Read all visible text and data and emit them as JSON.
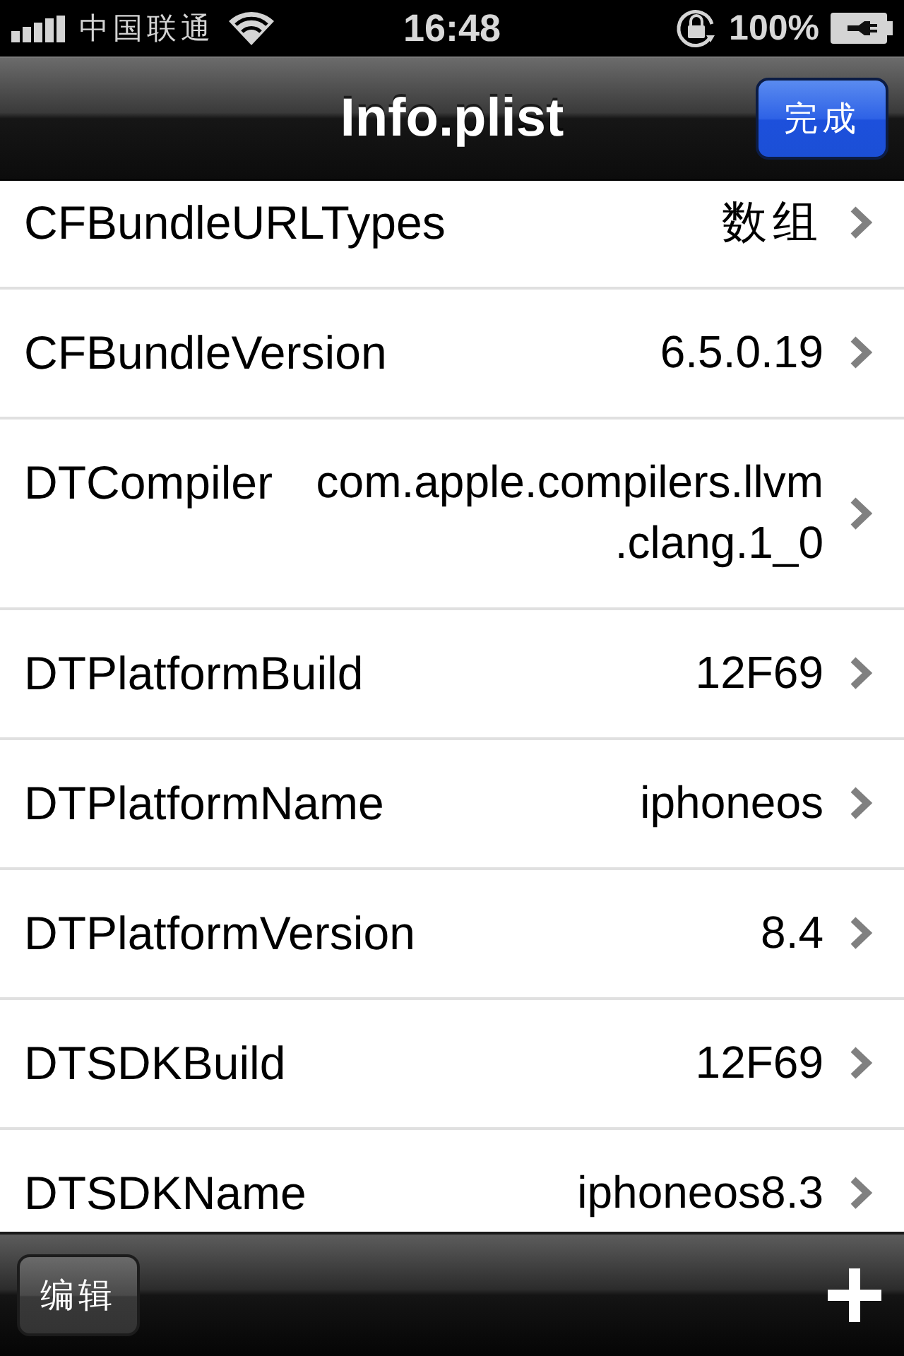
{
  "status_bar": {
    "carrier": "中国联通",
    "time": "16:48",
    "battery": "100%"
  },
  "nav_bar": {
    "title": "Info.plist",
    "done_button": "完成"
  },
  "rows": [
    {
      "key": "CFBundleURLTypes",
      "value": "数组"
    },
    {
      "key": "CFBundleVersion",
      "value": "6.5.0.19"
    },
    {
      "key": "DTCompiler",
      "value": "com.apple.compilers.llvm\n.clang.1_0"
    },
    {
      "key": "DTPlatformBuild",
      "value": "12F69"
    },
    {
      "key": "DTPlatformName",
      "value": "iphoneos"
    },
    {
      "key": "DTPlatformVersion",
      "value": "8.4"
    },
    {
      "key": "DTSDKBuild",
      "value": "12F69"
    },
    {
      "key": "DTSDKName",
      "value": "iphoneos8.3"
    }
  ],
  "toolbar": {
    "edit_button": "编辑"
  }
}
